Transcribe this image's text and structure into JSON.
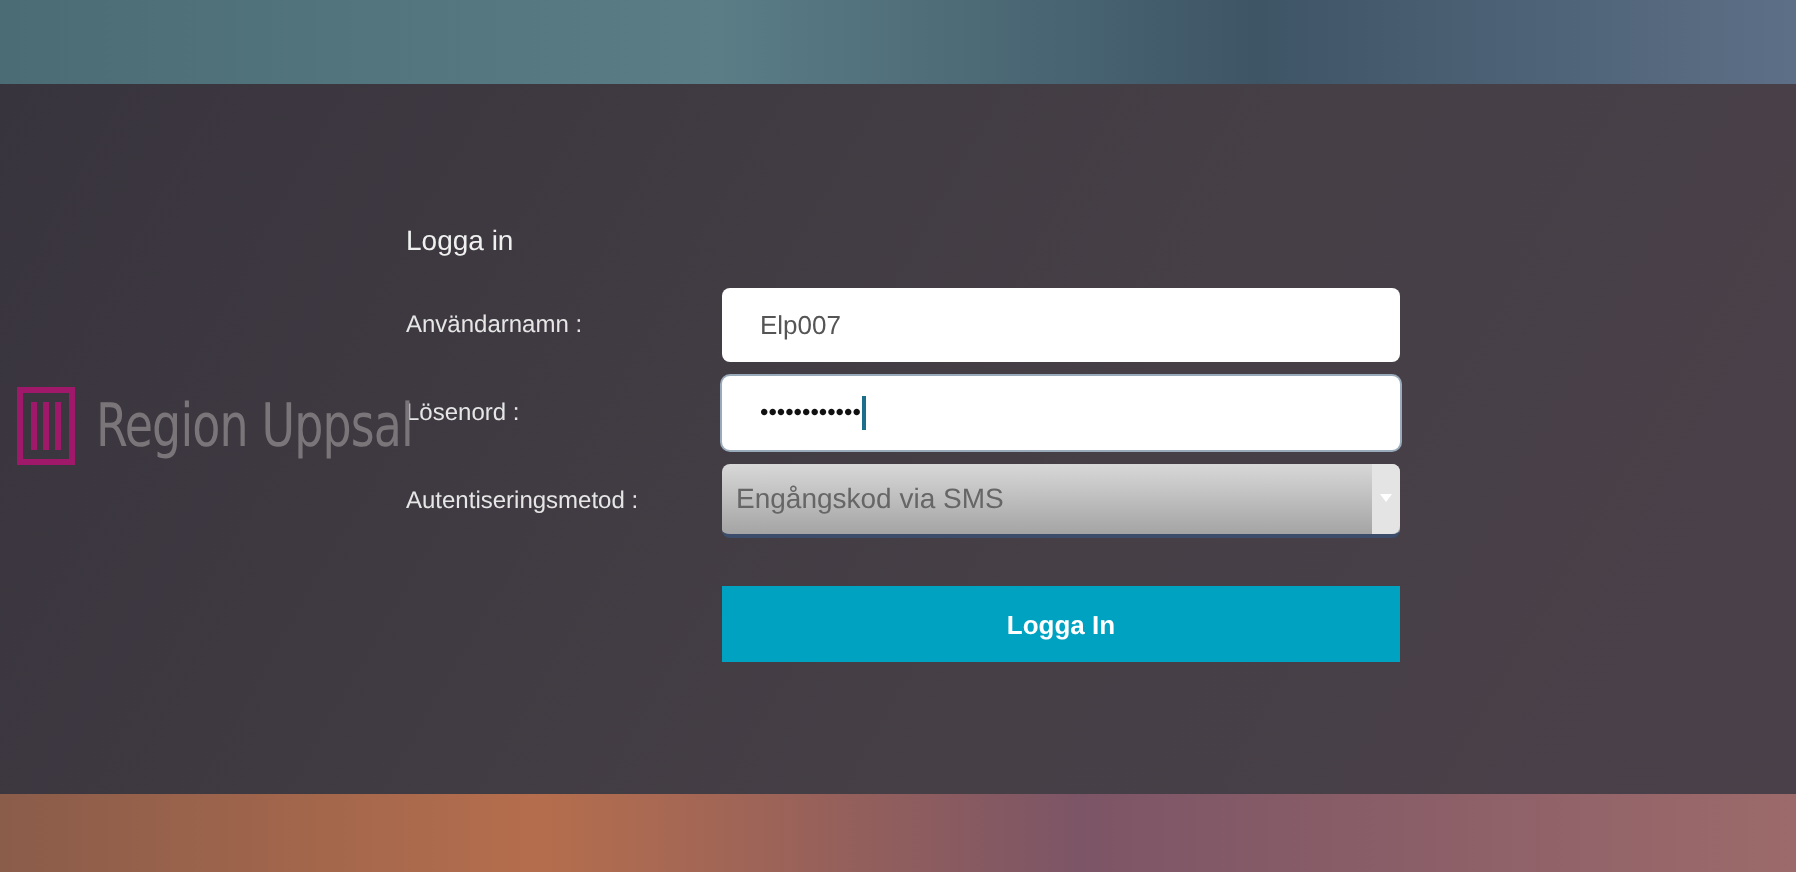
{
  "logo": {
    "text": "Region Uppsal"
  },
  "form": {
    "title": "Logga in",
    "fields": [
      {
        "kind": "text",
        "label": "Användarnamn :",
        "value": "Elp007"
      },
      {
        "kind": "password",
        "label": "Lösenord :",
        "value": "••••••••••••",
        "focused": true
      },
      {
        "kind": "select",
        "label": "Autentiseringsmetod :",
        "value": "Engångskod via SMS"
      }
    ],
    "button": "Logga In"
  }
}
